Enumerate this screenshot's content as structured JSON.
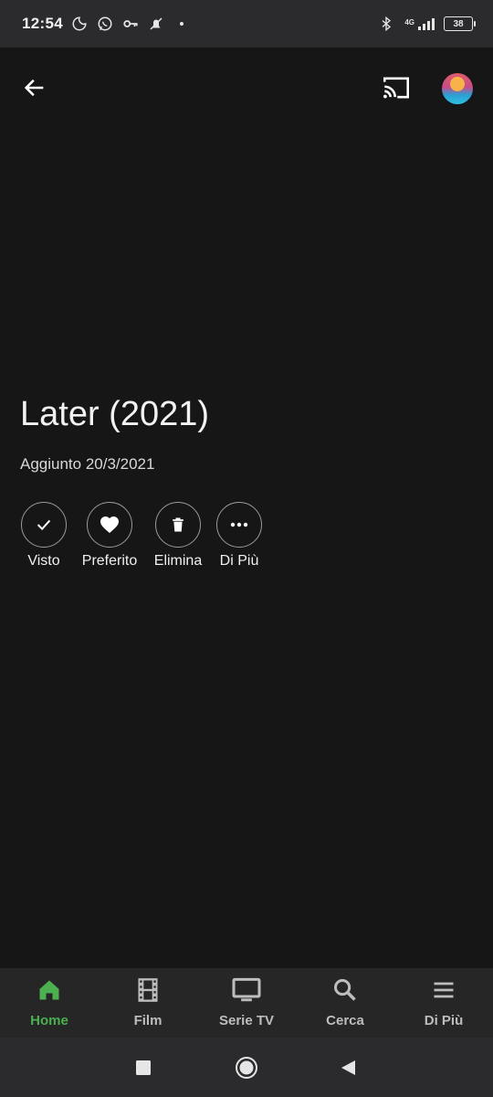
{
  "status_bar": {
    "time": "12:54",
    "network": "4G",
    "battery": "38"
  },
  "appbar": {
    "icons": [
      "back-arrow-icon",
      "cast-icon",
      "avatar"
    ]
  },
  "movie": {
    "title": "Later (2021)",
    "added": "Aggiunto 20/3/2021"
  },
  "actions": [
    {
      "label": "Visto",
      "icon": "check-icon"
    },
    {
      "label": "Preferito",
      "icon": "heart-icon"
    },
    {
      "label": "Elimina",
      "icon": "trash-icon"
    },
    {
      "label": "Di Più",
      "icon": "more-icon"
    }
  ],
  "bottom_nav": {
    "active": "Home",
    "items": [
      {
        "label": "Home",
        "icon": "home-icon"
      },
      {
        "label": "Film",
        "icon": "film-icon"
      },
      {
        "label": "Serie TV",
        "icon": "tv-icon"
      },
      {
        "label": "Cerca",
        "icon": "search-icon"
      },
      {
        "label": "Di Più",
        "icon": "menu-icon"
      }
    ]
  },
  "colors": {
    "background": "#161616",
    "accent": "#4caf50",
    "status_bar": "#2b2b2d",
    "bottom_nav": "#262626"
  }
}
